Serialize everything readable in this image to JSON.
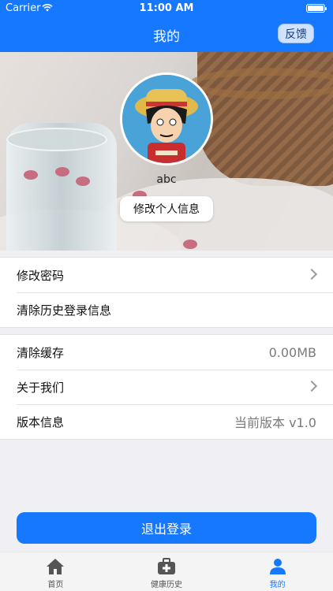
{
  "status": {
    "carrier": "Carrier",
    "time": "11:00 AM"
  },
  "nav": {
    "title": "我的",
    "feedback_label": "反馈"
  },
  "profile": {
    "username": "abc",
    "edit_label": "修改个人信息"
  },
  "group1": [
    {
      "label": "修改密码",
      "chevron": true
    },
    {
      "label": "清除历史登录信息",
      "chevron": false
    }
  ],
  "group2": [
    {
      "label": "清除缓存",
      "value": "0.00MB"
    },
    {
      "label": "关于我们",
      "chevron": true
    },
    {
      "label": "版本信息",
      "value": "当前版本 v1.0"
    }
  ],
  "logout_label": "退出登录",
  "tabs": [
    {
      "label": "首页",
      "icon": "home-icon",
      "active": false
    },
    {
      "label": "健康历史",
      "icon": "medical-kit-icon",
      "active": false
    },
    {
      "label": "我的",
      "icon": "person-icon",
      "active": true
    }
  ],
  "colors": {
    "accent": "#1677ff"
  }
}
